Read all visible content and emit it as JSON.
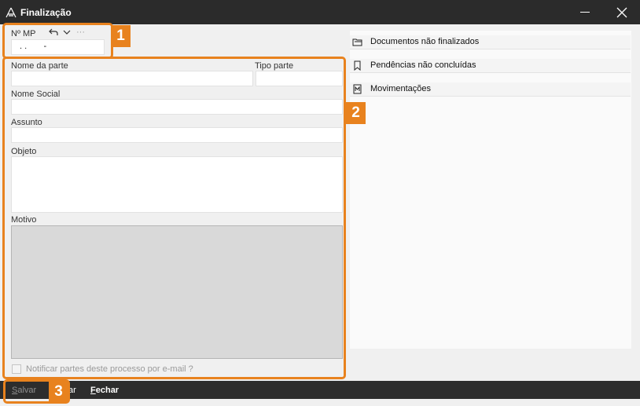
{
  "window": {
    "title": "Finalização"
  },
  "header": {
    "mp_label": "Nº MP",
    "mp_value": ". .       -",
    "more_label": "···"
  },
  "form": {
    "nome_parte_label": "Nome da parte",
    "tipo_parte_label": "Tipo parte",
    "nome_social_label": "Nome Social",
    "assunto_label": "Assunto",
    "objeto_label": "Objeto",
    "motivo_label": "Motivo",
    "notify_label": "Notificar partes deste processo por e-mail ?"
  },
  "right_panel": {
    "items": [
      {
        "label": "Documentos não finalizados",
        "icon": "folder-icon"
      },
      {
        "label": "Pendências não concluídas",
        "icon": "bookmark-icon"
      },
      {
        "label": "Movimentações",
        "icon": "document-m-icon"
      }
    ]
  },
  "toolbar": {
    "save_label": "Salvar",
    "save_accel": "S",
    "hidden_suffix": "ar",
    "close_label": "Fechar",
    "close_accel": "F"
  },
  "callouts": {
    "c1": "1",
    "c2": "2",
    "c3": "3"
  },
  "colors": {
    "accent": "#e8821e",
    "titlebar": "#2b2b2b",
    "bottombar": "#2d2d2d"
  }
}
